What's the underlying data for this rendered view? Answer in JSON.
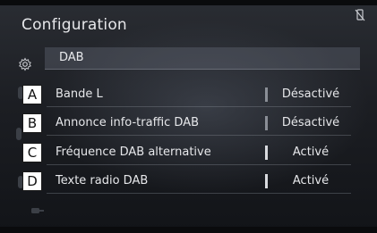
{
  "screen": {
    "title": "Configuration"
  },
  "tab": {
    "label": "DAB"
  },
  "rows": [
    {
      "label": "Bande L",
      "value": "Désactivé",
      "state": "off",
      "callout": "A"
    },
    {
      "label": "Annonce info-traffic DAB",
      "value": "Désactivé",
      "state": "off",
      "callout": "B"
    },
    {
      "label": "Fréquence DAB alternative",
      "value": "Activé",
      "state": "on",
      "callout": "C"
    },
    {
      "label": "Texte radio DAB",
      "value": "Activé",
      "state": "on",
      "callout": "D"
    }
  ],
  "icons": {
    "status": "no-phone-icon",
    "rail_settings": "gear-icon",
    "rail_bottom": "car-key-icon"
  },
  "colors": {
    "background": "#1c1e23",
    "text": "#e6e7ea",
    "callout_bg": "#ffffff",
    "divider_on": "#d8dade",
    "divider_off": "#8a8e96"
  }
}
